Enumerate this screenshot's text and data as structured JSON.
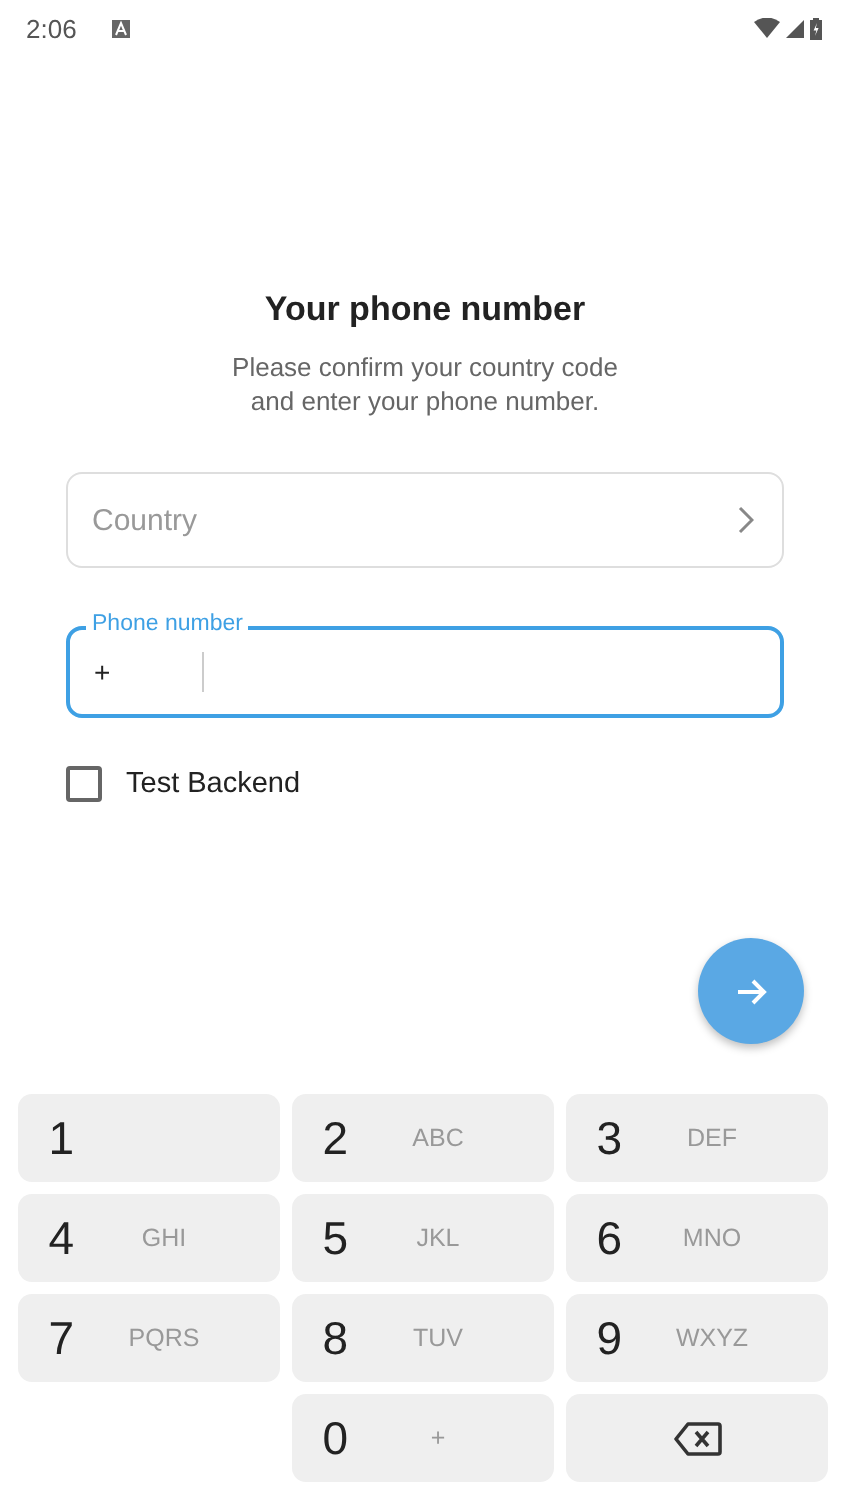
{
  "status_bar": {
    "time": "2:06"
  },
  "title": "Your phone number",
  "subtitle": "Please confirm your country code\nand enter your phone number.",
  "country_field": {
    "placeholder": "Country"
  },
  "phone_field": {
    "label": "Phone number",
    "prefix": "+"
  },
  "test_backend": {
    "label": "Test Backend",
    "checked": false
  },
  "keypad": [
    {
      "kind": "digit",
      "digit": "1"
    },
    {
      "kind": "digit",
      "digit": "2",
      "letters": "ABC"
    },
    {
      "kind": "digit",
      "digit": "3",
      "letters": "DEF"
    },
    {
      "kind": "digit",
      "digit": "4",
      "letters": "GHI"
    },
    {
      "kind": "digit",
      "digit": "5",
      "letters": "JKL"
    },
    {
      "kind": "digit",
      "digit": "6",
      "letters": "MNO"
    },
    {
      "kind": "digit",
      "digit": "7",
      "letters": "PQRS"
    },
    {
      "kind": "digit",
      "digit": "8",
      "letters": "TUV"
    },
    {
      "kind": "digit",
      "digit": "9",
      "letters": "WXYZ"
    },
    {
      "kind": "blank"
    },
    {
      "kind": "digit",
      "digit": "0",
      "letters": "+"
    },
    {
      "kind": "backspace"
    }
  ]
}
